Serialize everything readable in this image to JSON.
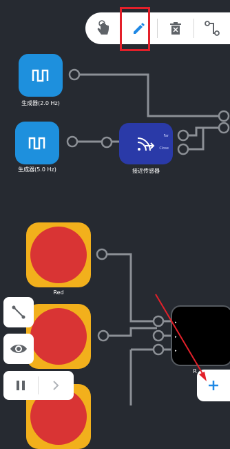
{
  "toolbar": {
    "tools": [
      "hand-tool-icon",
      "pencil-icon",
      "trash-icon",
      "wire-path-icon"
    ],
    "active_tool": "pencil-icon",
    "accent": "#1e88e5",
    "highlight_color": "#e3202a"
  },
  "nodes": {
    "generator_1": {
      "label": "生成器(2.0 Hz)",
      "color": "#1e90dd"
    },
    "generator_2": {
      "label": "生成器(5.0 Hz)",
      "color": "#1e90dd"
    },
    "proximity_sensor": {
      "label": "接近传感器",
      "pin_1": "Far",
      "pin_2": "Close",
      "color": "#2a3aa8"
    },
    "lamp_red": {
      "label": "Red",
      "color": "#d93434",
      "frame": "#f2b01c"
    },
    "output_node": {
      "label": "R"
    }
  },
  "controls": {
    "wire_button": "line-icon",
    "visibility_button": "eye-icon",
    "pause_button": "pause-icon",
    "next_button": "chevron-right-icon",
    "add_button": "plus-icon"
  },
  "annotation": {
    "arrow_color": "#e3202a"
  }
}
